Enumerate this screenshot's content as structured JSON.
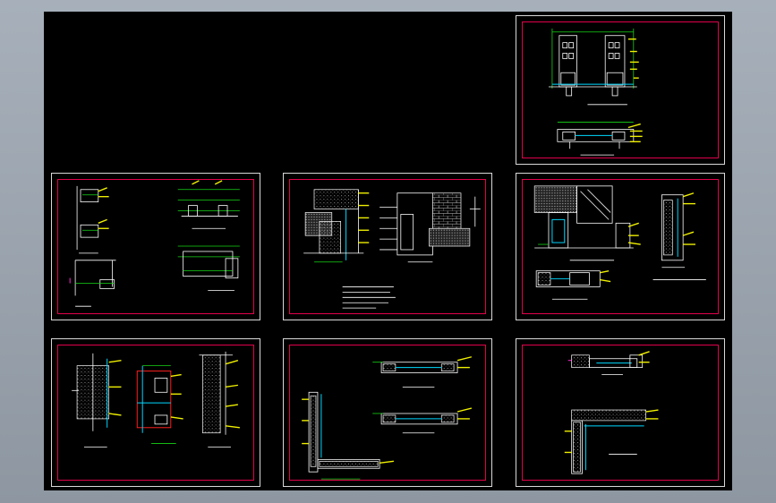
{
  "viewport": {
    "background": "#000000",
    "frame_color": "#e0004a",
    "sheet_border": "#d8d8d8"
  },
  "colors": {
    "line": "#ffffff",
    "dimension": "#17d617",
    "leader": "#f0f000",
    "glass": "#00d8ff",
    "mark": "#ff2bd6"
  },
  "sheets": [
    {
      "id": "sheet-top-right",
      "row": 0,
      "col": 2
    },
    {
      "id": "sheet-mid-left",
      "row": 1,
      "col": 0
    },
    {
      "id": "sheet-mid-center",
      "row": 1,
      "col": 1
    },
    {
      "id": "sheet-mid-right",
      "row": 1,
      "col": 2
    },
    {
      "id": "sheet-bottom-left",
      "row": 2,
      "col": 0
    },
    {
      "id": "sheet-bottom-center",
      "row": 2,
      "col": 1
    },
    {
      "id": "sheet-bottom-right",
      "row": 2,
      "col": 2
    }
  ]
}
